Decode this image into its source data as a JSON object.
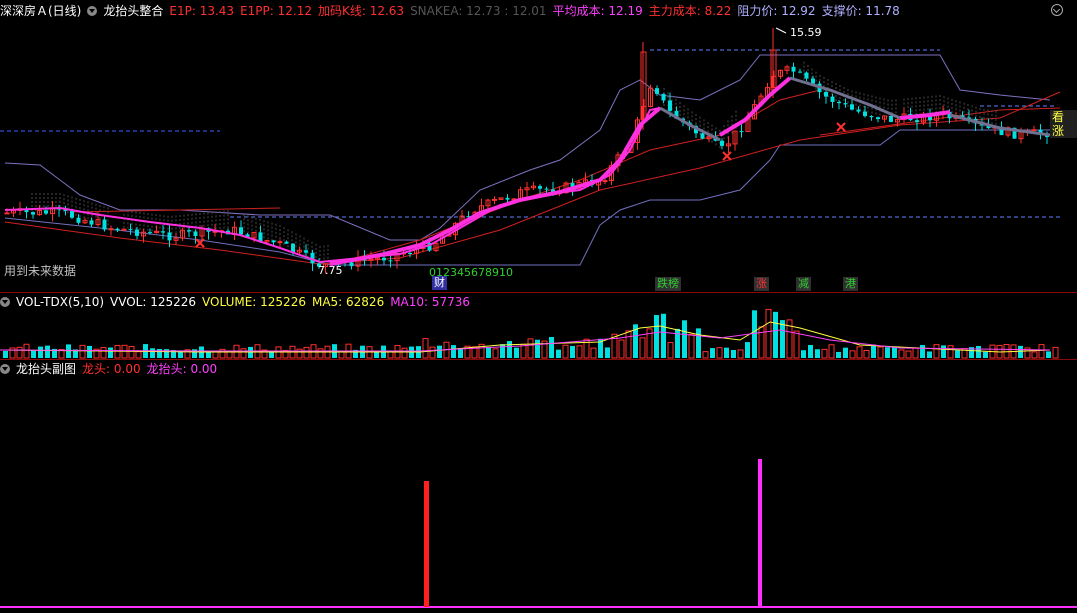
{
  "main_header": {
    "stock": "深深房Ａ(日线)",
    "indicator": "龙抬头整合",
    "items": [
      {
        "label": "E1P: 13.43",
        "color": "#ff3030"
      },
      {
        "label": "E1PP: 12.12",
        "color": "#ff3030"
      },
      {
        "label": "加码K线: 12.63",
        "color": "#ff3030"
      },
      {
        "label": "SNAKEA: 12.73 : 12.01",
        "color": "#555555"
      },
      {
        "label": "平均成本: 12.19",
        "color": "#ff40ff"
      },
      {
        "label": "主力成本: 8.22",
        "color": "#ff3030"
      },
      {
        "label": "阻力价: 12.92",
        "color": "#b0b0ff"
      },
      {
        "label": "支撑价: 11.78",
        "color": "#b0b0ff"
      }
    ]
  },
  "annotations": {
    "high_price": "15.59",
    "low_price": "7.75",
    "count_seq": "012345678910",
    "future_data": "用到未来数据",
    "kan_zhang": "看涨",
    "cai": "财",
    "badges": [
      {
        "label": "跌榜",
        "color": "#30d030",
        "bg": "#303030"
      },
      {
        "label": "涨",
        "color": "#ff3030",
        "bg": "#303030"
      },
      {
        "label": "减",
        "color": "#30d030",
        "bg": "#303030"
      },
      {
        "label": "港",
        "color": "#30d030",
        "bg": "#303030"
      }
    ]
  },
  "vol_header": {
    "name": "VOL-TDX(5,10)",
    "items": [
      {
        "label": "VVOL: 125226",
        "color": "#ffffff"
      },
      {
        "label": "VOLUME: 125226",
        "color": "#ffff40"
      },
      {
        "label": "MA5: 62826",
        "color": "#ffff40"
      },
      {
        "label": "MA10: 57736",
        "color": "#ff40ff"
      }
    ]
  },
  "sub_header": {
    "name": "龙抬头副图",
    "items": [
      {
        "label": "龙头: 0.00",
        "color": "#ff3030"
      },
      {
        "label": "龙抬头: 0.00",
        "color": "#ff40ff"
      }
    ]
  },
  "colors": {
    "up": "#ff3030",
    "down": "#00e0e0",
    "ma_pink": "#ff30e0",
    "purple": "#9090ff",
    "grey": "#707070"
  },
  "icons": [
    "dropdown-icon",
    "zoom-icon"
  ]
}
